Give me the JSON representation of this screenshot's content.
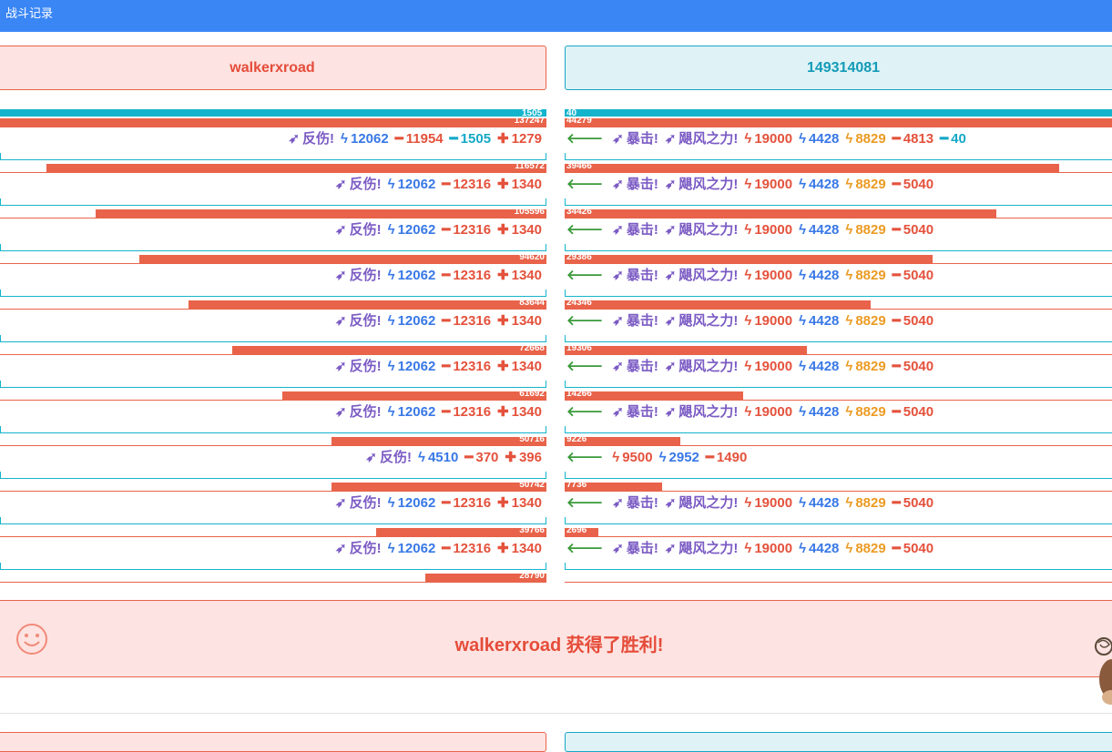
{
  "header": {
    "title": "战斗记录"
  },
  "players": {
    "left": "walkerxroad",
    "right": "149314081"
  },
  "colors": {
    "header": "#3a86f5",
    "hp": "#e8634a",
    "shield": "#14b4cc"
  },
  "rounds": [
    {
      "left_hp": "137247",
      "left_shield": "1505",
      "right_hp": "44279",
      "right_shield": "40",
      "left_hp_fill": 1.0,
      "right_hp_fill": 1.0,
      "left_log": [
        {
          "icon": "arrow-icon",
          "text": "反伤!",
          "color": "purple"
        },
        {
          "icon": "bolt-icon",
          "text": "12062",
          "color": "blue"
        },
        {
          "icon": "minus-icon",
          "text": "11954",
          "color": "red"
        },
        {
          "icon": "minus-icon",
          "text": "1505",
          "color": "cyan"
        },
        {
          "icon": "plus-icon",
          "text": "1279",
          "color": "red"
        }
      ],
      "right_log": [
        {
          "icon": "back-arrow-icon",
          "text": "",
          "color": "green"
        },
        {
          "icon": "arrow-icon",
          "text": "暴击!",
          "color": "purple"
        },
        {
          "icon": "arrow-icon",
          "text": "飓风之力!",
          "color": "purple"
        },
        {
          "icon": "bolt-icon",
          "text": "19000",
          "color": "red"
        },
        {
          "icon": "bolt-icon",
          "text": "4428",
          "color": "blue"
        },
        {
          "icon": "bolt-icon",
          "text": "8829",
          "color": "orange"
        },
        {
          "icon": "minus-icon",
          "text": "4813",
          "color": "red"
        },
        {
          "icon": "minus-icon",
          "text": "40",
          "color": "cyan"
        }
      ]
    },
    {
      "left_hp": "116572",
      "right_hp": "39466",
      "left_hp_fill": 0.915,
      "right_hp_fill": 0.89,
      "left_log": [
        {
          "icon": "arrow-icon",
          "text": "反伤!",
          "color": "purple"
        },
        {
          "icon": "bolt-icon",
          "text": "12062",
          "color": "blue"
        },
        {
          "icon": "minus-icon",
          "text": "12316",
          "color": "red"
        },
        {
          "icon": "plus-icon",
          "text": "1340",
          "color": "red"
        }
      ],
      "right_log": [
        {
          "icon": "back-arrow-icon",
          "text": "",
          "color": "green"
        },
        {
          "icon": "arrow-icon",
          "text": "暴击!",
          "color": "purple"
        },
        {
          "icon": "arrow-icon",
          "text": "飓风之力!",
          "color": "purple"
        },
        {
          "icon": "bolt-icon",
          "text": "19000",
          "color": "red"
        },
        {
          "icon": "bolt-icon",
          "text": "4428",
          "color": "blue"
        },
        {
          "icon": "bolt-icon",
          "text": "8829",
          "color": "orange"
        },
        {
          "icon": "minus-icon",
          "text": "5040",
          "color": "red"
        }
      ]
    },
    {
      "left_hp": "105596",
      "right_hp": "34426",
      "left_hp_fill": 0.825,
      "right_hp_fill": 0.777,
      "left_log": [
        {
          "icon": "arrow-icon",
          "text": "反伤!",
          "color": "purple"
        },
        {
          "icon": "bolt-icon",
          "text": "12062",
          "color": "blue"
        },
        {
          "icon": "minus-icon",
          "text": "12316",
          "color": "red"
        },
        {
          "icon": "plus-icon",
          "text": "1340",
          "color": "red"
        }
      ],
      "right_log": [
        {
          "icon": "back-arrow-icon",
          "text": "",
          "color": "green"
        },
        {
          "icon": "arrow-icon",
          "text": "暴击!",
          "color": "purple"
        },
        {
          "icon": "arrow-icon",
          "text": "飓风之力!",
          "color": "purple"
        },
        {
          "icon": "bolt-icon",
          "text": "19000",
          "color": "red"
        },
        {
          "icon": "bolt-icon",
          "text": "4428",
          "color": "blue"
        },
        {
          "icon": "bolt-icon",
          "text": "8829",
          "color": "orange"
        },
        {
          "icon": "minus-icon",
          "text": "5040",
          "color": "red"
        }
      ]
    },
    {
      "left_hp": "94620",
      "right_hp": "29386",
      "left_hp_fill": 0.745,
      "right_hp_fill": 0.663,
      "left_log": [
        {
          "icon": "arrow-icon",
          "text": "反伤!",
          "color": "purple"
        },
        {
          "icon": "bolt-icon",
          "text": "12062",
          "color": "blue"
        },
        {
          "icon": "minus-icon",
          "text": "12316",
          "color": "red"
        },
        {
          "icon": "plus-icon",
          "text": "1340",
          "color": "red"
        }
      ],
      "right_log": [
        {
          "icon": "back-arrow-icon",
          "text": "",
          "color": "green"
        },
        {
          "icon": "arrow-icon",
          "text": "暴击!",
          "color": "purple"
        },
        {
          "icon": "arrow-icon",
          "text": "飓风之力!",
          "color": "purple"
        },
        {
          "icon": "bolt-icon",
          "text": "19000",
          "color": "red"
        },
        {
          "icon": "bolt-icon",
          "text": "4428",
          "color": "blue"
        },
        {
          "icon": "bolt-icon",
          "text": "8829",
          "color": "orange"
        },
        {
          "icon": "minus-icon",
          "text": "5040",
          "color": "red"
        }
      ]
    },
    {
      "left_hp": "83644",
      "right_hp": "24346",
      "left_hp_fill": 0.655,
      "right_hp_fill": 0.55,
      "left_log": [
        {
          "icon": "arrow-icon",
          "text": "反伤!",
          "color": "purple"
        },
        {
          "icon": "bolt-icon",
          "text": "12062",
          "color": "blue"
        },
        {
          "icon": "minus-icon",
          "text": "12316",
          "color": "red"
        },
        {
          "icon": "plus-icon",
          "text": "1340",
          "color": "red"
        }
      ],
      "right_log": [
        {
          "icon": "back-arrow-icon",
          "text": "",
          "color": "green"
        },
        {
          "icon": "arrow-icon",
          "text": "暴击!",
          "color": "purple"
        },
        {
          "icon": "arrow-icon",
          "text": "飓风之力!",
          "color": "purple"
        },
        {
          "icon": "bolt-icon",
          "text": "19000",
          "color": "red"
        },
        {
          "icon": "bolt-icon",
          "text": "4428",
          "color": "blue"
        },
        {
          "icon": "bolt-icon",
          "text": "8829",
          "color": "orange"
        },
        {
          "icon": "minus-icon",
          "text": "5040",
          "color": "red"
        }
      ]
    },
    {
      "left_hp": "72668",
      "right_hp": "19306",
      "left_hp_fill": 0.575,
      "right_hp_fill": 0.436,
      "left_log": [
        {
          "icon": "arrow-icon",
          "text": "反伤!",
          "color": "purple"
        },
        {
          "icon": "bolt-icon",
          "text": "12062",
          "color": "blue"
        },
        {
          "icon": "minus-icon",
          "text": "12316",
          "color": "red"
        },
        {
          "icon": "plus-icon",
          "text": "1340",
          "color": "red"
        }
      ],
      "right_log": [
        {
          "icon": "back-arrow-icon",
          "text": "",
          "color": "green"
        },
        {
          "icon": "arrow-icon",
          "text": "暴击!",
          "color": "purple"
        },
        {
          "icon": "arrow-icon",
          "text": "飓风之力!",
          "color": "purple"
        },
        {
          "icon": "bolt-icon",
          "text": "19000",
          "color": "red"
        },
        {
          "icon": "bolt-icon",
          "text": "4428",
          "color": "blue"
        },
        {
          "icon": "bolt-icon",
          "text": "8829",
          "color": "orange"
        },
        {
          "icon": "minus-icon",
          "text": "5040",
          "color": "red"
        }
      ]
    },
    {
      "left_hp": "61692",
      "right_hp": "14266",
      "left_hp_fill": 0.483,
      "right_hp_fill": 0.322,
      "left_log": [
        {
          "icon": "arrow-icon",
          "text": "反伤!",
          "color": "purple"
        },
        {
          "icon": "bolt-icon",
          "text": "12062",
          "color": "blue"
        },
        {
          "icon": "minus-icon",
          "text": "12316",
          "color": "red"
        },
        {
          "icon": "plus-icon",
          "text": "1340",
          "color": "red"
        }
      ],
      "right_log": [
        {
          "icon": "back-arrow-icon",
          "text": "",
          "color": "green"
        },
        {
          "icon": "arrow-icon",
          "text": "暴击!",
          "color": "purple"
        },
        {
          "icon": "arrow-icon",
          "text": "飓风之力!",
          "color": "purple"
        },
        {
          "icon": "bolt-icon",
          "text": "19000",
          "color": "red"
        },
        {
          "icon": "bolt-icon",
          "text": "4428",
          "color": "blue"
        },
        {
          "icon": "bolt-icon",
          "text": "8829",
          "color": "orange"
        },
        {
          "icon": "minus-icon",
          "text": "5040",
          "color": "red"
        }
      ]
    },
    {
      "left_hp": "50716",
      "right_hp": "9226",
      "left_hp_fill": 0.393,
      "right_hp_fill": 0.208,
      "left_log": [
        {
          "icon": "arrow-icon",
          "text": "反伤!",
          "color": "purple"
        },
        {
          "icon": "bolt-icon",
          "text": "4510",
          "color": "blue"
        },
        {
          "icon": "minus-icon",
          "text": "370",
          "color": "red"
        },
        {
          "icon": "plus-icon",
          "text": "396",
          "color": "red"
        }
      ],
      "right_log": [
        {
          "icon": "back-arrow-icon",
          "text": "",
          "color": "green"
        },
        {
          "icon": "bolt-icon",
          "text": "9500",
          "color": "red"
        },
        {
          "icon": "bolt-icon",
          "text": "2952",
          "color": "blue"
        },
        {
          "icon": "minus-icon",
          "text": "1490",
          "color": "red"
        }
      ]
    },
    {
      "left_hp": "50742",
      "right_hp": "7736",
      "left_hp_fill": 0.393,
      "right_hp_fill": 0.175,
      "left_log": [
        {
          "icon": "arrow-icon",
          "text": "反伤!",
          "color": "purple"
        },
        {
          "icon": "bolt-icon",
          "text": "12062",
          "color": "blue"
        },
        {
          "icon": "minus-icon",
          "text": "12316",
          "color": "red"
        },
        {
          "icon": "plus-icon",
          "text": "1340",
          "color": "red"
        }
      ],
      "right_log": [
        {
          "icon": "back-arrow-icon",
          "text": "",
          "color": "green"
        },
        {
          "icon": "arrow-icon",
          "text": "暴击!",
          "color": "purple"
        },
        {
          "icon": "arrow-icon",
          "text": "飓风之力!",
          "color": "purple"
        },
        {
          "icon": "bolt-icon",
          "text": "19000",
          "color": "red"
        },
        {
          "icon": "bolt-icon",
          "text": "4428",
          "color": "blue"
        },
        {
          "icon": "bolt-icon",
          "text": "8829",
          "color": "orange"
        },
        {
          "icon": "minus-icon",
          "text": "5040",
          "color": "red"
        }
      ]
    },
    {
      "left_hp": "39766",
      "right_hp": "2696",
      "left_hp_fill": 0.312,
      "right_hp_fill": 0.061,
      "left_log": [
        {
          "icon": "arrow-icon",
          "text": "反伤!",
          "color": "purple"
        },
        {
          "icon": "bolt-icon",
          "text": "12062",
          "color": "blue"
        },
        {
          "icon": "minus-icon",
          "text": "12316",
          "color": "red"
        },
        {
          "icon": "plus-icon",
          "text": "1340",
          "color": "red"
        }
      ],
      "right_log": [
        {
          "icon": "back-arrow-icon",
          "text": "",
          "color": "green"
        },
        {
          "icon": "arrow-icon",
          "text": "暴击!",
          "color": "purple"
        },
        {
          "icon": "arrow-icon",
          "text": "飓风之力!",
          "color": "purple"
        },
        {
          "icon": "bolt-icon",
          "text": "19000",
          "color": "red"
        },
        {
          "icon": "bolt-icon",
          "text": "4428",
          "color": "blue"
        },
        {
          "icon": "bolt-icon",
          "text": "8829",
          "color": "orange"
        },
        {
          "icon": "minus-icon",
          "text": "5040",
          "color": "red"
        }
      ]
    },
    {
      "left_hp": "28790",
      "right_hp": "",
      "left_hp_fill": 0.222,
      "right_hp_fill": 0.0
    }
  ],
  "victory": {
    "player": "walkerxroad",
    "text": " 获得了胜利!"
  }
}
